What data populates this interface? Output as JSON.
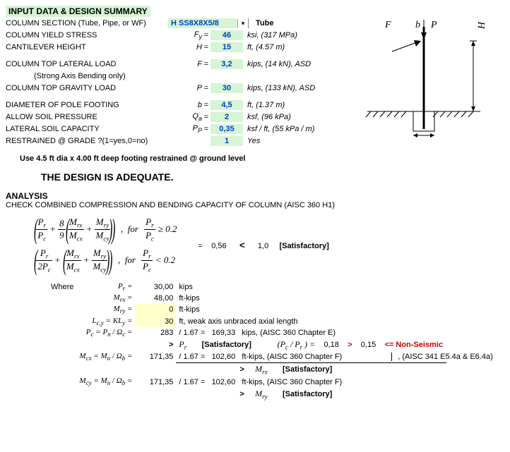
{
  "header": "INPUT DATA & DESIGN SUMMARY",
  "inputs": {
    "section": {
      "label": "COLUMN SECTION (Tube, Pipe, or WF)",
      "value": "H SS8X8X5/8",
      "shape": "Tube"
    },
    "fy": {
      "label": "COLUMN YIELD STRESS",
      "sym": "F y",
      "value": "46",
      "unit": "ksi, (317 MPa)"
    },
    "h": {
      "label": "CANTILEVER HEIGHT",
      "sym": "H",
      "value": "15",
      "unit": "ft, (4.57 m)"
    },
    "f": {
      "label": "COLUMN TOP LATERAL LOAD",
      "sub": "(Strong Axis Bending only)",
      "sym": "F",
      "value": "3,2",
      "unit": "kips, (14 kN), ASD"
    },
    "p": {
      "label": "COLUMN TOP GRAVITY LOAD",
      "sym": "P",
      "value": "30",
      "unit": "kips, (133 kN), ASD"
    },
    "b": {
      "label": "DIAMETER OF POLE FOOTING",
      "sym": "b",
      "value": "4,5",
      "unit": "ft, (1.37 m)"
    },
    "qa": {
      "label": "ALLOW SOIL PRESSURE",
      "sym": "Q a",
      "value": "2",
      "unit": "ksf, (96 kPa)"
    },
    "pp": {
      "label": "LATERAL SOIL CAPACITY",
      "sym": "P P",
      "value": "0,35",
      "unit": "ksf / ft, (55 kPa / m)"
    },
    "rest": {
      "label": "RESTRAINED @ GRADE ?(1=yes,0=no)",
      "sym": "",
      "value": "1",
      "unit": "Yes"
    }
  },
  "note": "Use  4.5 ft dia x 4.00 ft  deep   footing restrained @ ground level",
  "result": "THE DESIGN IS ADEQUATE.",
  "analysis": {
    "title": "ANALYSIS",
    "check": "CHECK COMBINED COMPRESSION AND BENDING CAPACITY OF COLUMN (AISC 360 H1)",
    "ratio": "0,56",
    "limit": "1,0",
    "verdict": "[Satisfactory]",
    "where": "Where",
    "vals": {
      "Pr": {
        "sym": "P r =",
        "v": "30,00",
        "u": "kips"
      },
      "Mrx": {
        "sym": "M rx =",
        "v": "48,00",
        "u": "ft-kips"
      },
      "Mry": {
        "sym": "M ry =",
        "v": "0",
        "u": "ft-kips"
      },
      "Lcy": {
        "sym": "L c,y = KL y =",
        "v": "30",
        "u": "ft, weak axis unbraced axial length"
      },
      "Pc": {
        "sym": "P c = P n / Ω c =",
        "v": "283",
        "u2": "/ 1.67 =",
        "v2": "169,33",
        "u3": "kips, (AISC 360 Chapter E)"
      },
      "PcPr": {
        "pre": ">",
        "sym": "P r",
        "sat": "[Satisfactory]",
        "ratlabel": "(P c / P r )  =",
        "rat": "0,18",
        "gt": ">",
        "lim": "0,15",
        "post": "<=  Non-Seismic"
      },
      "Mcx": {
        "sym": "M cx = M n / Ω b =",
        "v": "171,35",
        "u2": "/ 1.67 =",
        "v2": "102,60",
        "u3": "ft-kips, (AISC 360 Chapter F)",
        "post": ", (AISC 341 E5.4a & E6.4a)"
      },
      "Mcx2": {
        "pre": ">",
        "sym": "M rx",
        "sat": "[Satisfactory]"
      },
      "Mcy": {
        "sym": "M cy = M n / Ω b =",
        "v": "171,35",
        "u2": "/ 1.67 =",
        "v2": "102,60",
        "u3": "ft-kips, (AISC 360 Chapter F)"
      },
      "Mcy2": {
        "pre": ">",
        "sym": "M ry",
        "sat": "[Satisfactory]"
      }
    }
  },
  "fig": {
    "P": "P",
    "F": "F",
    "H": "H",
    "b": "b"
  }
}
